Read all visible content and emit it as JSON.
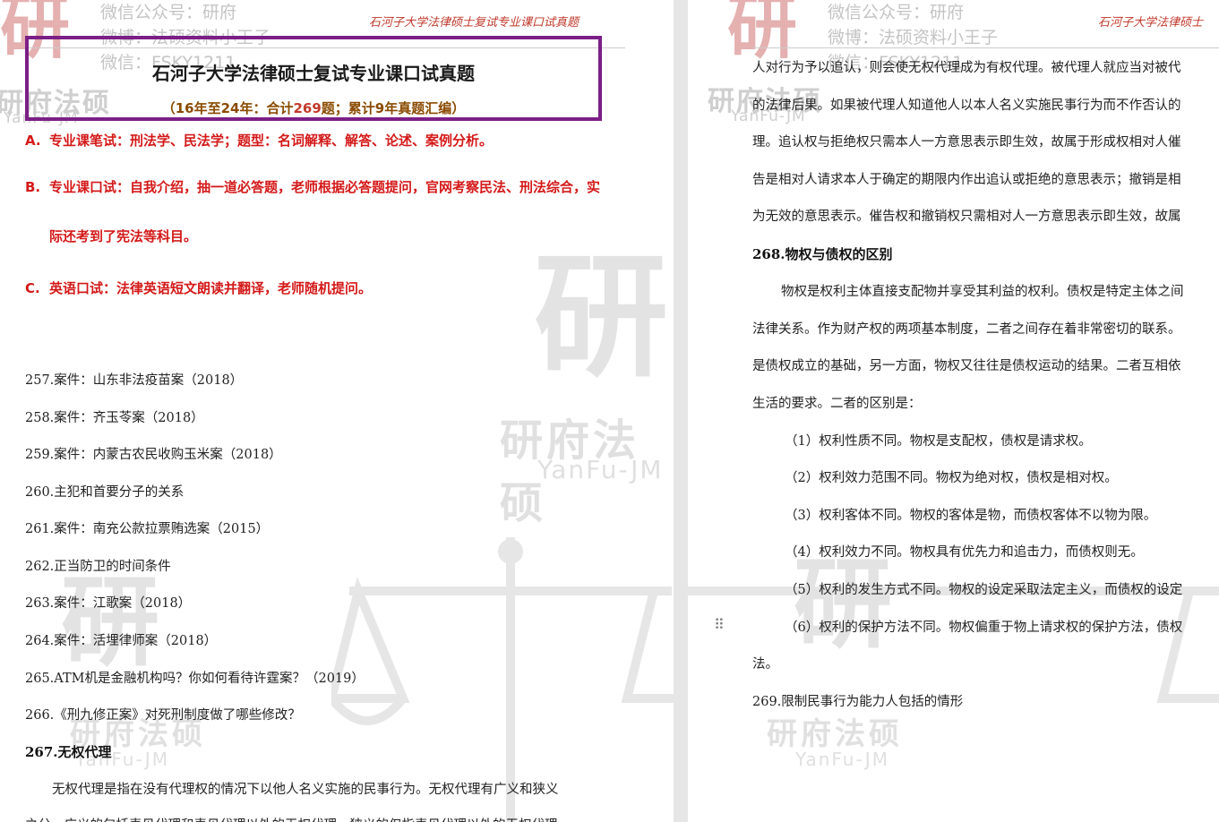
{
  "watermark": {
    "wechat": "微信公众号：研府",
    "weibo": "微博：法硕资料小王子",
    "weixin": "微信：FSKY1211",
    "brand": "研府法硕",
    "brand_en": "YanFu-JM",
    "seal": "研"
  },
  "left_page": {
    "running_head": "石河子大学法律硕士复试专业课口试真题",
    "title": "石河子大学法律硕士复试专业课口试真题",
    "subtitle": {
      "prefix": "（16年至24年：合计",
      "count": "269",
      "suffix": "题；累计9年真题汇编）"
    },
    "requirements": [
      {
        "key": "A.",
        "text": "专业课笔试：刑法学、民法学；题型：名词解释、解答、论述、案例分析。"
      },
      {
        "key": "B.",
        "text": "专业课口试：自我介绍，抽一道必答题，老师根据必答题提问，官网考察民法、刑法综合，实",
        "text2": "际还考到了宪法等科目。"
      },
      {
        "key": "C.",
        "text": "英语口试：法律英语短文朗读并翻译，老师随机提问。"
      }
    ],
    "questions": [
      "257.案件：山东非法疫苗案（2018）",
      "258.案件：齐玉苓案（2018）",
      "259.案件：内蒙古农民收购玉米案（2018）",
      "260.主犯和首要分子的关系",
      "261.案件：南充公款拉票贿选案（2015）",
      "262.正当防卫的时间条件",
      "263.案件：江歌案（2018）",
      "264.案件：活埋律师案（2018）",
      "265.ATM机是金融机构吗？你如何看待许霆案？（2019）",
      "266.《刑九修正案》对死刑制度做了哪些修改？"
    ],
    "q267_heading": "267.无权代理",
    "q267_body": [
      "无权代理是指在没有代理权的情况下以他人名义实施的民事行为。无权代理有广义和狭义",
      "之分，广义的包括表见代理和表见代理以外的无权代理，狭义的仅指表见代理以外的无权代理。"
    ]
  },
  "right_page": {
    "running_head": "石河子大学法律硕士",
    "body_top": [
      "人对行为予以追认，则会使无权代理成为有权代理。被代理人就应当对被代",
      "的法律后果。如果被代理人知道他人以本人名义实施民事行为而不作否认的",
      "理。追认权与拒绝权只需本人一方意思表示即生效，故属于形成权相对人催",
      "告是相对人请求本人于确定的期限内作出追认或拒绝的意思表示；撤销是相",
      "为无效的意思表示。催告权和撤销权只需相对人一方意思表示即生效，故属"
    ],
    "q268_heading": "268.物权与债权的区别",
    "q268_body": [
      "物权是权利主体直接支配物并享受其利益的权利。债权是特定主体之间",
      "法律关系。作为财产权的两项基本制度，二者之间存在着非常密切的联系。",
      "是债权成立的基础，另一方面，物权又往往是债权运动的结果。二者互相依",
      "生活的要求。二者的区别是："
    ],
    "q268_points": [
      "（1）权利性质不同。物权是支配权，债权是请求权。",
      "（2）权利效力范围不同。物权为绝对权，债权是相对权。",
      "（3）权利客体不同。物权的客体是物，而债权客体不以物为限。",
      "（4）权利效力不同。物权具有优先力和追击力，而债权则无。",
      "（5）权利的发生方式不同。物权的设定采取法定主义，而债权的设定",
      "（6）权利的保护方法不同。物权偏重于物上请求权的保护方法，债权"
    ],
    "q268_tail": "法。",
    "q269_heading": "269.限制民事行为能力人包括的情形"
  }
}
